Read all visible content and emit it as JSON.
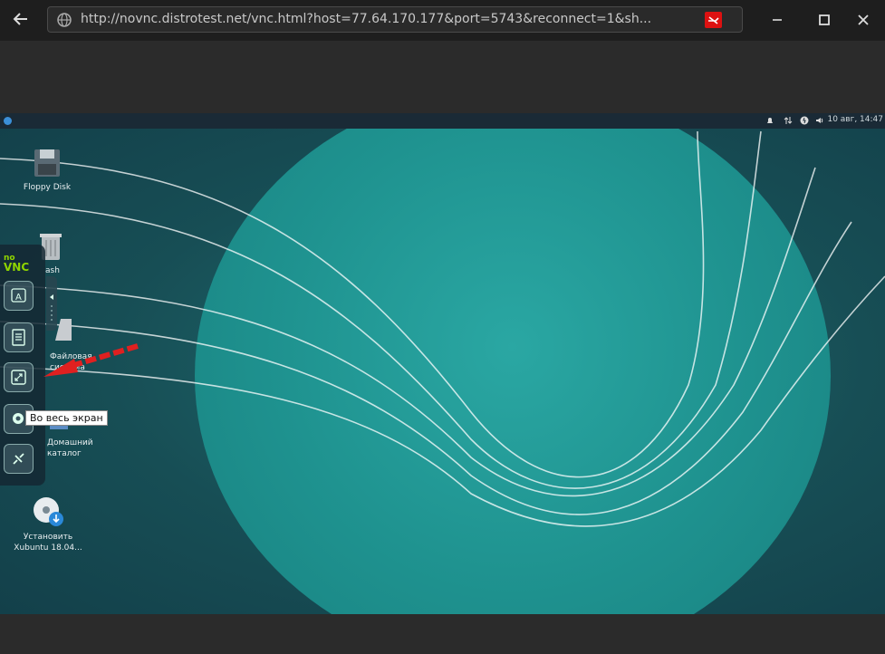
{
  "browser": {
    "url": "http://novnc.distrotest.net/vnc.html?host=77.64.170.177&port=5743&reconnect=1&sh..."
  },
  "panel": {
    "clock": "10 авг, 14:47"
  },
  "desktop_icons": [
    {
      "label": "Floppy Disk"
    },
    {
      "label": "ash"
    },
    {
      "label": "Файловая\nсистема"
    },
    {
      "label": "Домашний\nкаталог"
    },
    {
      "label": "Установить\nXubuntu 18.04..."
    }
  ],
  "novnc": {
    "logo_top": "no",
    "logo_bottom": "VNC",
    "tooltip": "Во весь экран"
  },
  "colors": {
    "desktop_bg": "#174e55",
    "circle": "#1f9390",
    "arrow": "#e02020"
  }
}
